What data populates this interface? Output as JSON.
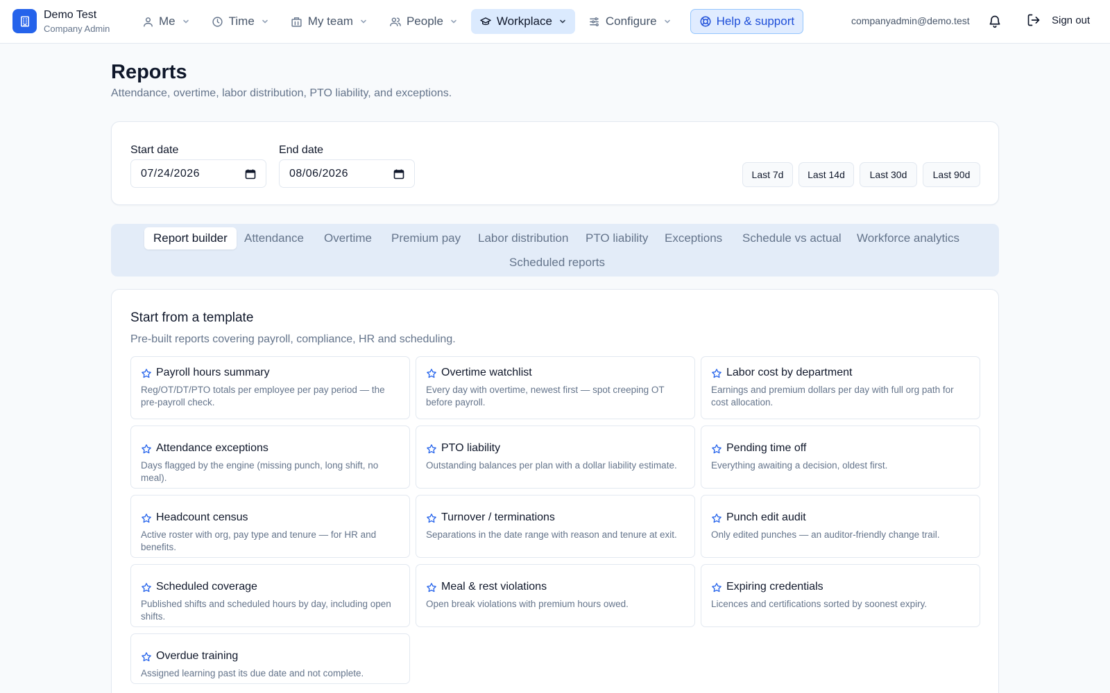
{
  "brand": {
    "name": "Demo Test",
    "role": "Company Admin"
  },
  "nav": {
    "items": [
      {
        "label": "Me",
        "icon": "user-icon"
      },
      {
        "label": "Time",
        "icon": "clock-icon"
      },
      {
        "label": "My team",
        "icon": "building-icon"
      },
      {
        "label": "People",
        "icon": "users-icon"
      },
      {
        "label": "Workplace",
        "icon": "graduation-cap-icon",
        "active": true
      },
      {
        "label": "Configure",
        "icon": "sliders-icon"
      }
    ],
    "help_label": "Help & support",
    "user_email": "companyadmin@demo.test",
    "sign_out_label": "Sign out"
  },
  "header": {
    "title": "Reports",
    "subtitle": "Attendance, overtime, labor distribution, PTO liability, and exceptions."
  },
  "date_filter": {
    "start_label": "Start date",
    "start_value": "07/24/2026",
    "end_label": "End date",
    "end_value": "08/06/2026",
    "ranges": [
      "Last 7d",
      "Last 14d",
      "Last 30d",
      "Last 90d"
    ]
  },
  "tabs": [
    "Report builder",
    "Attendance",
    "Overtime",
    "Premium pay",
    "Labor distribution",
    "PTO liability",
    "Exceptions",
    "Schedule vs actual",
    "Workforce analytics",
    "Scheduled reports"
  ],
  "templates": {
    "title": "Start from a template",
    "subtitle": "Pre-built reports covering payroll, compliance, HR and scheduling.",
    "items": [
      {
        "name": "Payroll hours summary",
        "desc": "Reg/OT/DT/PTO totals per employee per pay period — the pre-payroll check."
      },
      {
        "name": "Overtime watchlist",
        "desc": "Every day with overtime, newest first — spot creeping OT before payroll."
      },
      {
        "name": "Labor cost by department",
        "desc": "Earnings and premium dollars per day with full org path for cost allocation."
      },
      {
        "name": "Attendance exceptions",
        "desc": "Days flagged by the engine (missing punch, long shift, no meal)."
      },
      {
        "name": "PTO liability",
        "desc": "Outstanding balances per plan with a dollar liability estimate."
      },
      {
        "name": "Pending time off",
        "desc": "Everything awaiting a decision, oldest first."
      },
      {
        "name": "Headcount census",
        "desc": "Active roster with org, pay type and tenure — for HR and benefits."
      },
      {
        "name": "Turnover / terminations",
        "desc": "Separations in the date range with reason and tenure at exit."
      },
      {
        "name": "Punch edit audit",
        "desc": "Only edited punches — an auditor-friendly change trail."
      },
      {
        "name": "Scheduled coverage",
        "desc": "Published shifts and scheduled hours by day, including open shifts."
      },
      {
        "name": "Meal & rest violations",
        "desc": "Open break violations with premium hours owed."
      },
      {
        "name": "Expiring credentials",
        "desc": "Licences and certifications sorted by soonest expiry."
      },
      {
        "name": "Overdue training",
        "desc": "Assigned learning past its due date and not complete."
      }
    ]
  }
}
